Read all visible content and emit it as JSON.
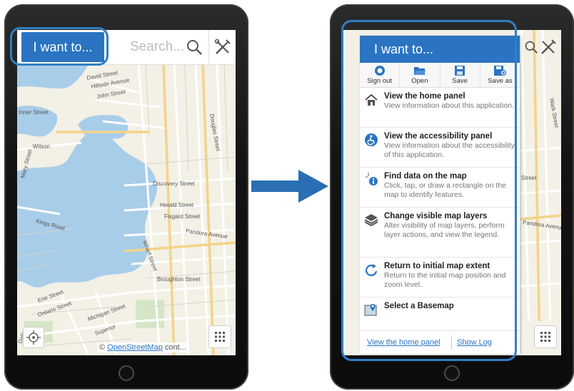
{
  "left_screen": {
    "i_want_button": "I want to...",
    "search_placeholder": "Search...",
    "attribution": {
      "symbol": "©",
      "link": "OpenStreetMap",
      "suffix": "cont..."
    },
    "map_labels": {
      "inner_street": "Inner Street",
      "david_street": "David Street",
      "hillside_avenue": "Hillside Avenue",
      "john_street": "John Street",
      "mary_street": "Mary Street",
      "wilson": "Wilson",
      "discovery_street": "Discovery Street",
      "herald_street": "Herald Street",
      "fisgard_street": "Fisgard Street",
      "pandora_avenue": "Pandora Avenue",
      "wharf_street": "Wharf Street",
      "douglas_street": "Douglas Street",
      "erie_street": "Erie Street",
      "ontario_street": "Ontario Street",
      "michigan_street": "Michigan Street",
      "superior": "Superior",
      "dallas": "Dallas",
      "kings_road": "Kings Road",
      "broughton": "Broughton Street"
    }
  },
  "right_screen": {
    "panel_title": "I want to...",
    "toolbar": [
      {
        "label": "Sign out",
        "icon": "sign-out-icon"
      },
      {
        "label": "Open",
        "icon": "folder-open-icon"
      },
      {
        "label": "Save",
        "icon": "save-icon"
      },
      {
        "label": "Save as",
        "icon": "save-as-icon"
      }
    ],
    "items": [
      {
        "title": "View the home panel",
        "desc": "View information about this application.",
        "icon": "home-icon"
      },
      {
        "title": "View the accessibility panel",
        "desc": "View information about the accessibility of this application.",
        "icon": "accessibility-icon"
      },
      {
        "title": "Find data on the map",
        "desc": "Click, tap, or draw a rectangle on the map to identify features.",
        "icon": "identify-icon"
      },
      {
        "title": "Change visible map layers",
        "desc": "Alter visibility of map layers, perform layer actions, and view the legend.",
        "icon": "layers-icon"
      },
      {
        "title": "Return to initial map extent",
        "desc": "Return to the initial map position and zoom level.",
        "icon": "refresh-extent-icon"
      },
      {
        "title": "Select a Basemap",
        "desc": "",
        "icon": "basemap-icon"
      }
    ],
    "footer": {
      "home_link": "View the home panel",
      "log_link": "Show Log"
    },
    "map_labels": {
      "wark_street": "Wark Street",
      "street": "Street",
      "pandora_avenue": "Pandora Avenue"
    }
  },
  "colors": {
    "accent": "#2a74c2",
    "highlight": "#2f7fc4",
    "arrow": "#2a6fb3"
  }
}
